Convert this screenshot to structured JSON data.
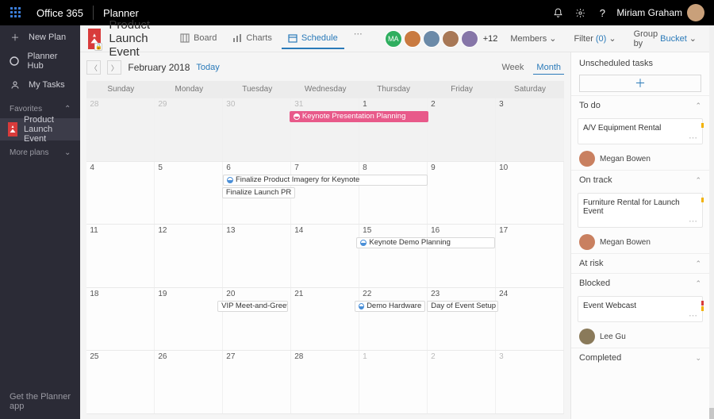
{
  "topbar": {
    "brand": "Office 365",
    "app": "Planner",
    "user": "Miriam Graham"
  },
  "sidebar": {
    "new_plan": "New Plan",
    "hub": "Planner Hub",
    "my_tasks": "My Tasks",
    "favorites_label": "Favorites",
    "more_plans": "More plans",
    "plan_name": "Product Launch Event",
    "foot": "Get the Planner app"
  },
  "plan": {
    "title": "Product Launch Event",
    "tabs": {
      "board": "Board",
      "charts": "Charts",
      "schedule": "Schedule"
    },
    "members_more": "+12",
    "cmd": {
      "members": "Members",
      "filter": "Filter",
      "filter_count": "(0)",
      "group_by_pre": "Group by",
      "group_by_val": "Bucket"
    }
  },
  "calendar": {
    "month": "February 2018",
    "today": "Today",
    "view_week": "Week",
    "view_month": "Month",
    "days": [
      "Sunday",
      "Monday",
      "Tuesday",
      "Wednesday",
      "Thursday",
      "Friday",
      "Saturday"
    ],
    "weeks": [
      {
        "nums": [
          "28",
          "29",
          "30",
          "31",
          "1",
          "2",
          "3"
        ],
        "otherMask": [
          1,
          1,
          1,
          1,
          0,
          0,
          0
        ],
        "events": [
          {
            "start": 3,
            "span": 2,
            "label": "Keynote Presentation Planning",
            "style": "pink",
            "dot": true
          }
        ]
      },
      {
        "nums": [
          "4",
          "5",
          "6",
          "7",
          "8",
          "9",
          "10"
        ],
        "events": [
          {
            "start": 2,
            "span": 3,
            "label": "Finalize Product Imagery for Keynote",
            "dot": true
          },
          {
            "start": 2,
            "span": 1,
            "label": "Finalize Launch PR",
            "plain": true
          }
        ]
      },
      {
        "nums": [
          "11",
          "12",
          "13",
          "14",
          "15",
          "16",
          "17"
        ],
        "events": [
          {
            "start": 4,
            "span": 2,
            "label": "Keynote Demo Planning",
            "dot": true
          }
        ]
      },
      {
        "nums": [
          "18",
          "19",
          "20",
          "21",
          "22",
          "23",
          "24"
        ],
        "events": [
          {
            "start": 2,
            "span": 1,
            "label": "VIP Meet-and-Greet",
            "plain": true
          },
          {
            "start": 4,
            "span": 1,
            "label": "Demo Hardware",
            "dot": true
          },
          {
            "start": 5,
            "span": 1,
            "label": "Day of Event Setup",
            "plain": true
          }
        ]
      },
      {
        "nums": [
          "25",
          "26",
          "27",
          "28",
          "1",
          "2",
          "3"
        ],
        "otherMask": [
          0,
          0,
          0,
          0,
          1,
          1,
          1
        ],
        "events": []
      }
    ]
  },
  "right": {
    "unscheduled": "Unscheduled tasks",
    "buckets": {
      "todo": "To do",
      "ontrack": "On track",
      "atrisk": "At risk",
      "blocked": "Blocked",
      "completed": "Completed"
    },
    "cards": {
      "todo": {
        "title": "A/V Equipment Rental",
        "assignee": "Megan Bowen"
      },
      "ontrack": {
        "title": "Furniture Rental for Launch Event",
        "assignee": "Megan Bowen"
      },
      "blocked": {
        "title": "Event Webcast",
        "assignee": "Lee Gu"
      }
    }
  },
  "avatars": {
    "ma": "#2fae5f",
    "p2": "#c97a40",
    "p3": "#6b8aa8",
    "p4": "#a87856",
    "p5": "#8676a8",
    "megan": "#c98060",
    "lee": "#8a7a5a",
    "miriam": "#c9a07a"
  }
}
